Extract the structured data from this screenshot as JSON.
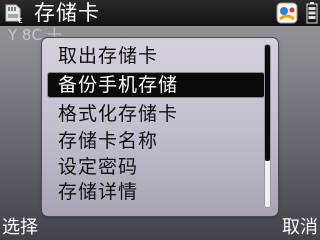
{
  "titlebar": {
    "title": "存储卡"
  },
  "background_text": "Y   8C  十",
  "menu": {
    "items": [
      {
        "label": "取出存储卡",
        "selected": false
      },
      {
        "label": "备份手机存储",
        "selected": true
      },
      {
        "label": "格式化存储卡",
        "selected": false
      },
      {
        "label": "存储卡名称",
        "selected": false
      },
      {
        "label": "设定密码",
        "selected": false
      },
      {
        "label": "存储详情",
        "selected": false
      }
    ]
  },
  "softkeys": {
    "left": "选择",
    "right": "取消"
  },
  "colors": {
    "selection": "#0a0a0a",
    "popup": "#c7c1d0"
  },
  "icons": {
    "title_icon": "memory-card-icon",
    "top_right_icon": "app-status-icon",
    "battery_icon": "battery-icon"
  }
}
